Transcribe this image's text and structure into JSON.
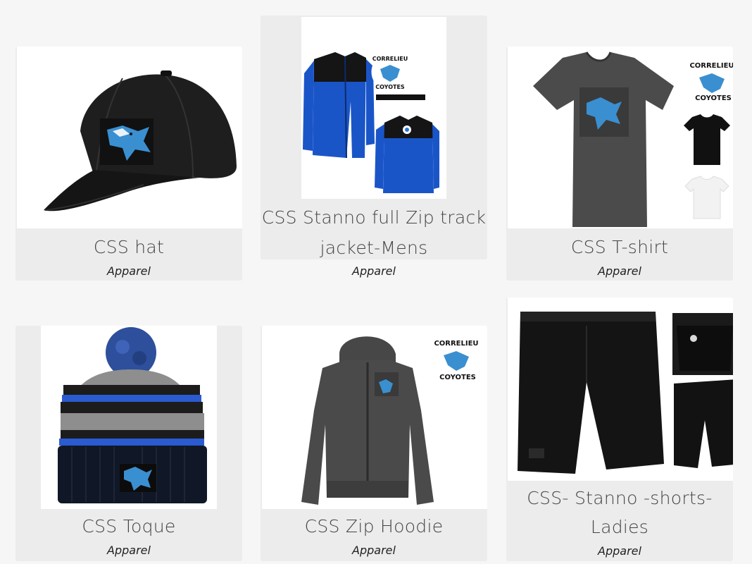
{
  "products": [
    {
      "title": "CSS hat",
      "category": "Apparel",
      "image_icon": "baseball-cap-icon"
    },
    {
      "title_line1": "CSS Stanno full Zip track",
      "title_line2": "jacket-Mens",
      "category": "Apparel",
      "image_icon": "track-jacket-icon"
    },
    {
      "title": "CSS T-shirt",
      "category": "Apparel",
      "image_icon": "t-shirt-icon"
    },
    {
      "title": "CSS Toque",
      "category": "Apparel",
      "image_icon": "toque-icon"
    },
    {
      "title": "CSS Zip Hoodie",
      "category": "Apparel",
      "image_icon": "zip-hoodie-icon"
    },
    {
      "title_line1": "CSS- Stanno -shorts-",
      "title_line2": "Ladies",
      "category": "Apparel",
      "image_icon": "shorts-icon"
    }
  ],
  "logo": {
    "text_top": "CORRELIEU",
    "text_bottom": "COYOTES"
  },
  "colors": {
    "card_bg": "#ececec",
    "page_bg": "#f6f6f6",
    "accent_blue": "#1f5fd6",
    "dark": "#1b1b1b"
  }
}
